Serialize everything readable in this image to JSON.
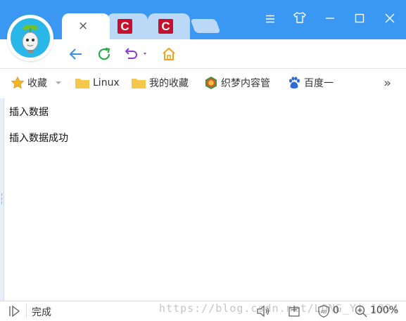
{
  "titlebar": {
    "tabs": [
      {
        "type": "active",
        "close_glyph": "×"
      },
      {
        "type": "site",
        "icon": "c-logo-icon"
      },
      {
        "type": "site",
        "icon": "c-logo-icon"
      },
      {
        "type": "new-tab"
      }
    ],
    "window_controls": [
      "menu-icon",
      "skin-icon",
      "minimize-icon",
      "maximize-icon",
      "close-icon"
    ]
  },
  "navbar": {
    "buttons": [
      "back-arrow-icon",
      "refresh-icon",
      "undo-icon",
      "home-icon"
    ]
  },
  "bookmarks": {
    "items": [
      {
        "label": "收藏",
        "icon": "star-icon",
        "has_dropdown": true
      },
      {
        "label": "Linux",
        "icon": "folder-icon"
      },
      {
        "label": "我的收藏",
        "icon": "folder-icon"
      },
      {
        "label": "织梦内容管",
        "icon": "dedecms-icon"
      },
      {
        "label": "百度一",
        "icon": "baidu-paw-icon"
      }
    ],
    "overflow_glyph": "»"
  },
  "content": {
    "lines": [
      "插入数据",
      "插入数据成功"
    ]
  },
  "statusbar": {
    "status": "完成",
    "watermark": "https://blog.csdn.net/LONG_Yi_1994",
    "badge_count": "0",
    "zoom": "100%"
  },
  "colors": {
    "titlebar_bg": "#3a97f2",
    "tab_inactive": "#bcd8f7",
    "accent_blue": "#3a8ee6",
    "refresh_green": "#2aaa4a",
    "undo_purple": "#8a3fd1",
    "home_orange": "#f0a21a",
    "folder_yellow": "#f5c84c"
  }
}
